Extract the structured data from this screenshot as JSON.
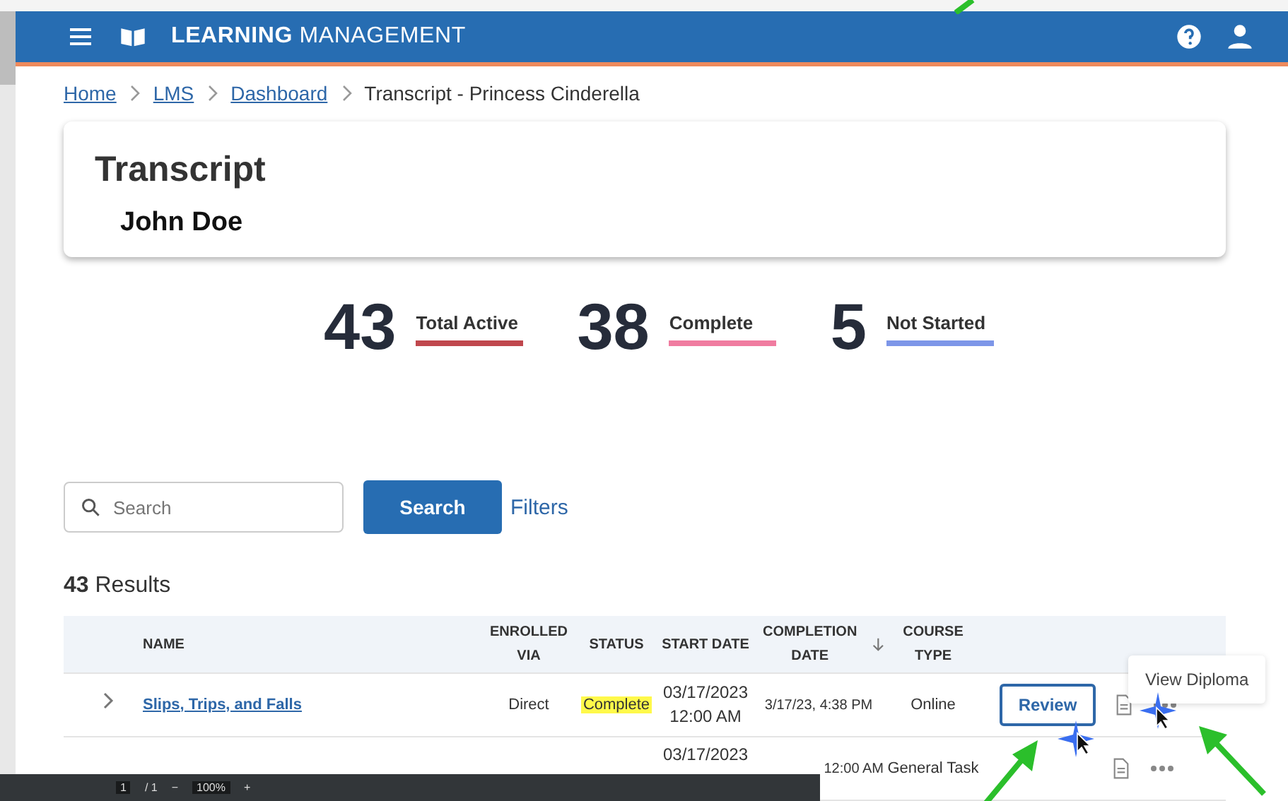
{
  "header": {
    "title_bold": "LEARNING",
    "title_rest": "MANAGEMENT"
  },
  "breadcrumb": [
    {
      "label": "Home",
      "link": true
    },
    {
      "label": "LMS",
      "link": true
    },
    {
      "label": "Dashboard",
      "link": true
    },
    {
      "label": "Transcript - Princess Cinderella",
      "link": false
    }
  ],
  "card": {
    "title": "Transcript",
    "name": "John Doe"
  },
  "stats": [
    {
      "value": "43",
      "label": "Total Active",
      "color": "#c0474d"
    },
    {
      "value": "38",
      "label": "Complete",
      "color": "#f07ca0"
    },
    {
      "value": "5",
      "label": "Not Started",
      "color": "#7d96e8"
    }
  ],
  "search": {
    "placeholder": "Search",
    "button": "Search",
    "filters": "Filters"
  },
  "results": {
    "count": "43",
    "label": "Results"
  },
  "table": {
    "columns": [
      {
        "label": "NAME",
        "sorted": false
      },
      {
        "label": "ENROLLED VIA",
        "sorted": false
      },
      {
        "label": "STATUS",
        "sorted": false
      },
      {
        "label": "START DATE",
        "sorted": false
      },
      {
        "label": "COMPLETION DATE",
        "sorted": true
      },
      {
        "label": "COURSE TYPE",
        "sorted": false
      }
    ],
    "rows": [
      {
        "name": "Slips, Trips, and Falls",
        "enrolled_via": "Direct",
        "status": "Complete",
        "start_date": "03/17/2023 12:00 AM",
        "completion_date": "3/17/23, 4:38 PM",
        "course_type": "Online",
        "action": "Review"
      },
      {
        "start_date": "03/17/2023",
        "completion_date": "12:00 AM",
        "course_type": "General Task"
      }
    ]
  },
  "tooltip": "View Diploma",
  "pdf_toolbar": {
    "page": "1",
    "pages": "/ 1",
    "minus": "−",
    "zoom": "100%",
    "plus": "+"
  }
}
